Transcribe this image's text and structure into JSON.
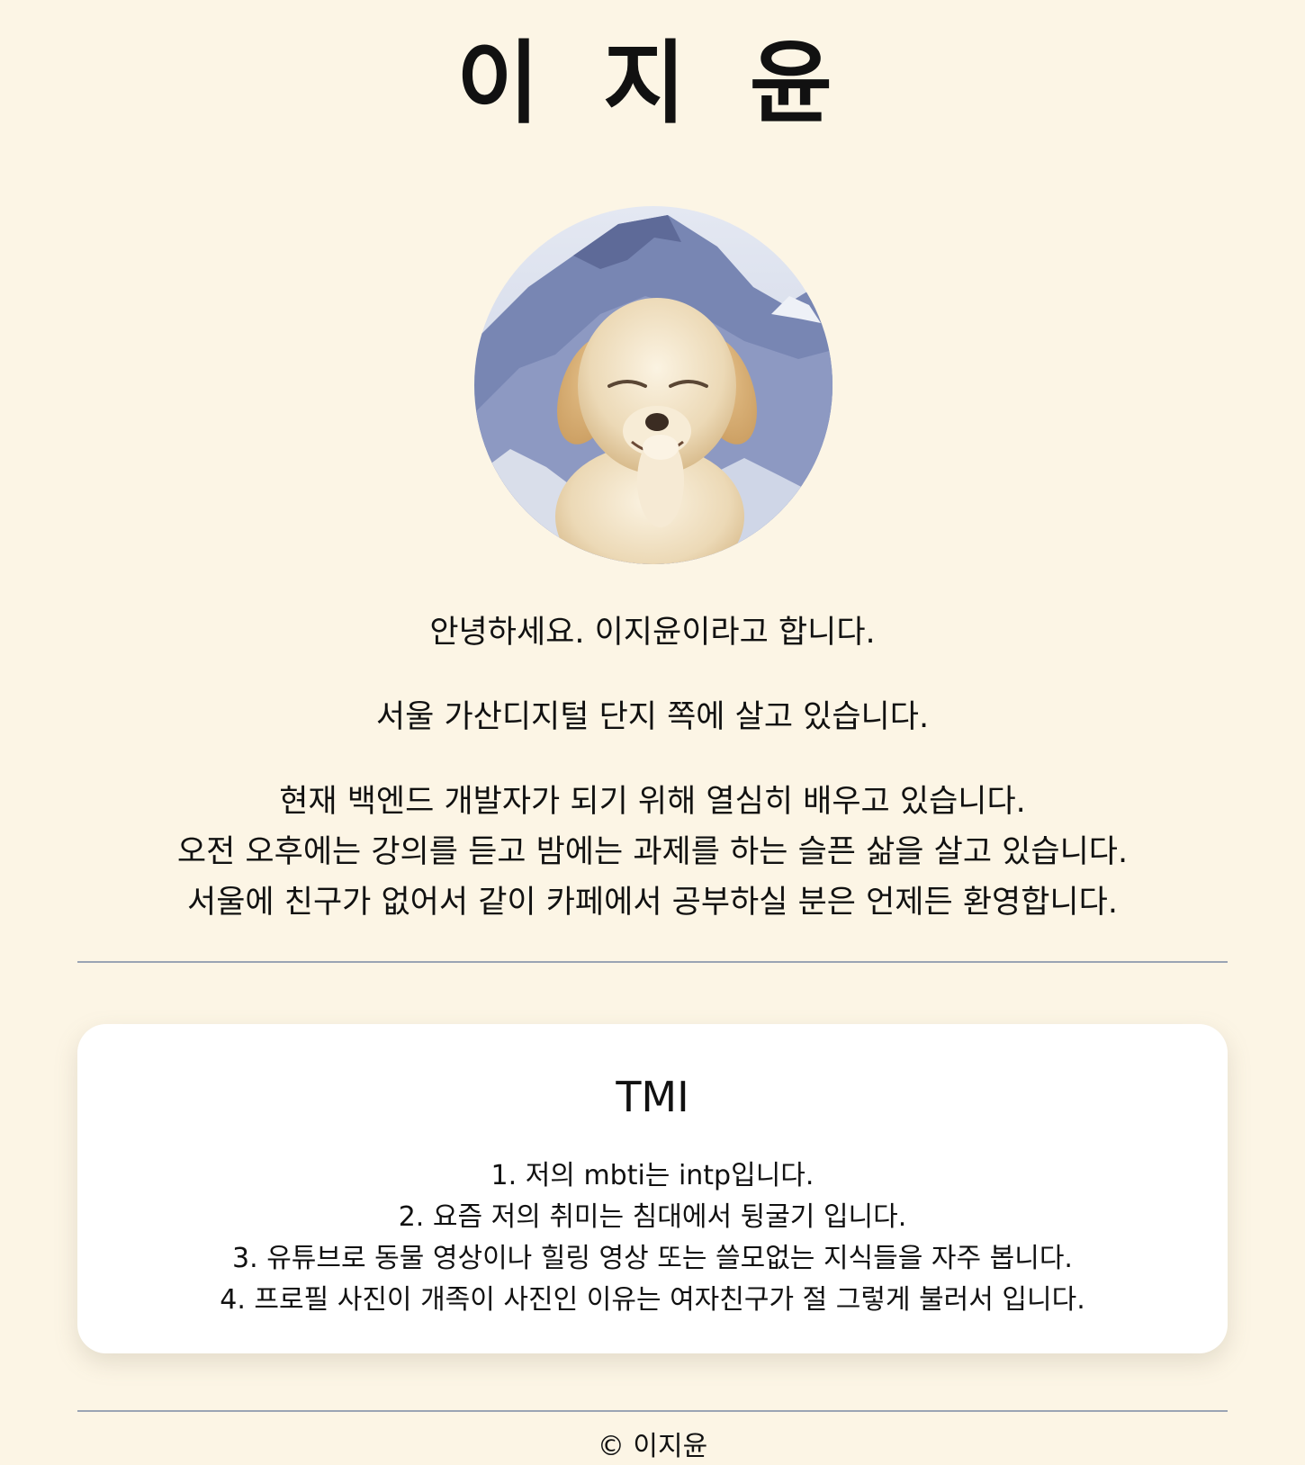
{
  "header": {
    "title": "이 지 윤"
  },
  "profile": {
    "avatar_icon": "puppy-photo"
  },
  "intro": {
    "line1": "안녕하세요. 이지윤이라고 합니다.",
    "line2": "서울 가산디지털 단지 쪽에 살고 있습니다.",
    "paragraph3": [
      "현재 백엔드 개발자가 되기 위해 열심히 배우고 있습니다.",
      "오전 오후에는 강의를 듣고 밤에는 과제를 하는 슬픈 삶을 살고 있습니다.",
      "서울에 친구가 없어서 같이 카페에서 공부하실 분은 언제든 환영합니다."
    ]
  },
  "tmi": {
    "title": "TMI",
    "items": [
      "1. 저의 mbti는 intp입니다.",
      "2. 요즘 저의 취미는 침대에서 뒹굴기 입니다.",
      "3. 유튜브로 동물 영상이나 힐링 영상 또는 쓸모없는 지식들을 자주 봅니다.",
      "4. 프로필 사진이 개족이 사진인 이유는 여자친구가 절 그렇게 불러서 입니다."
    ]
  },
  "footer": {
    "copyright": "© 이지윤"
  },
  "colors": {
    "background": "#fcf5e5",
    "card": "#ffffff",
    "divider": "#9aa4b4"
  }
}
